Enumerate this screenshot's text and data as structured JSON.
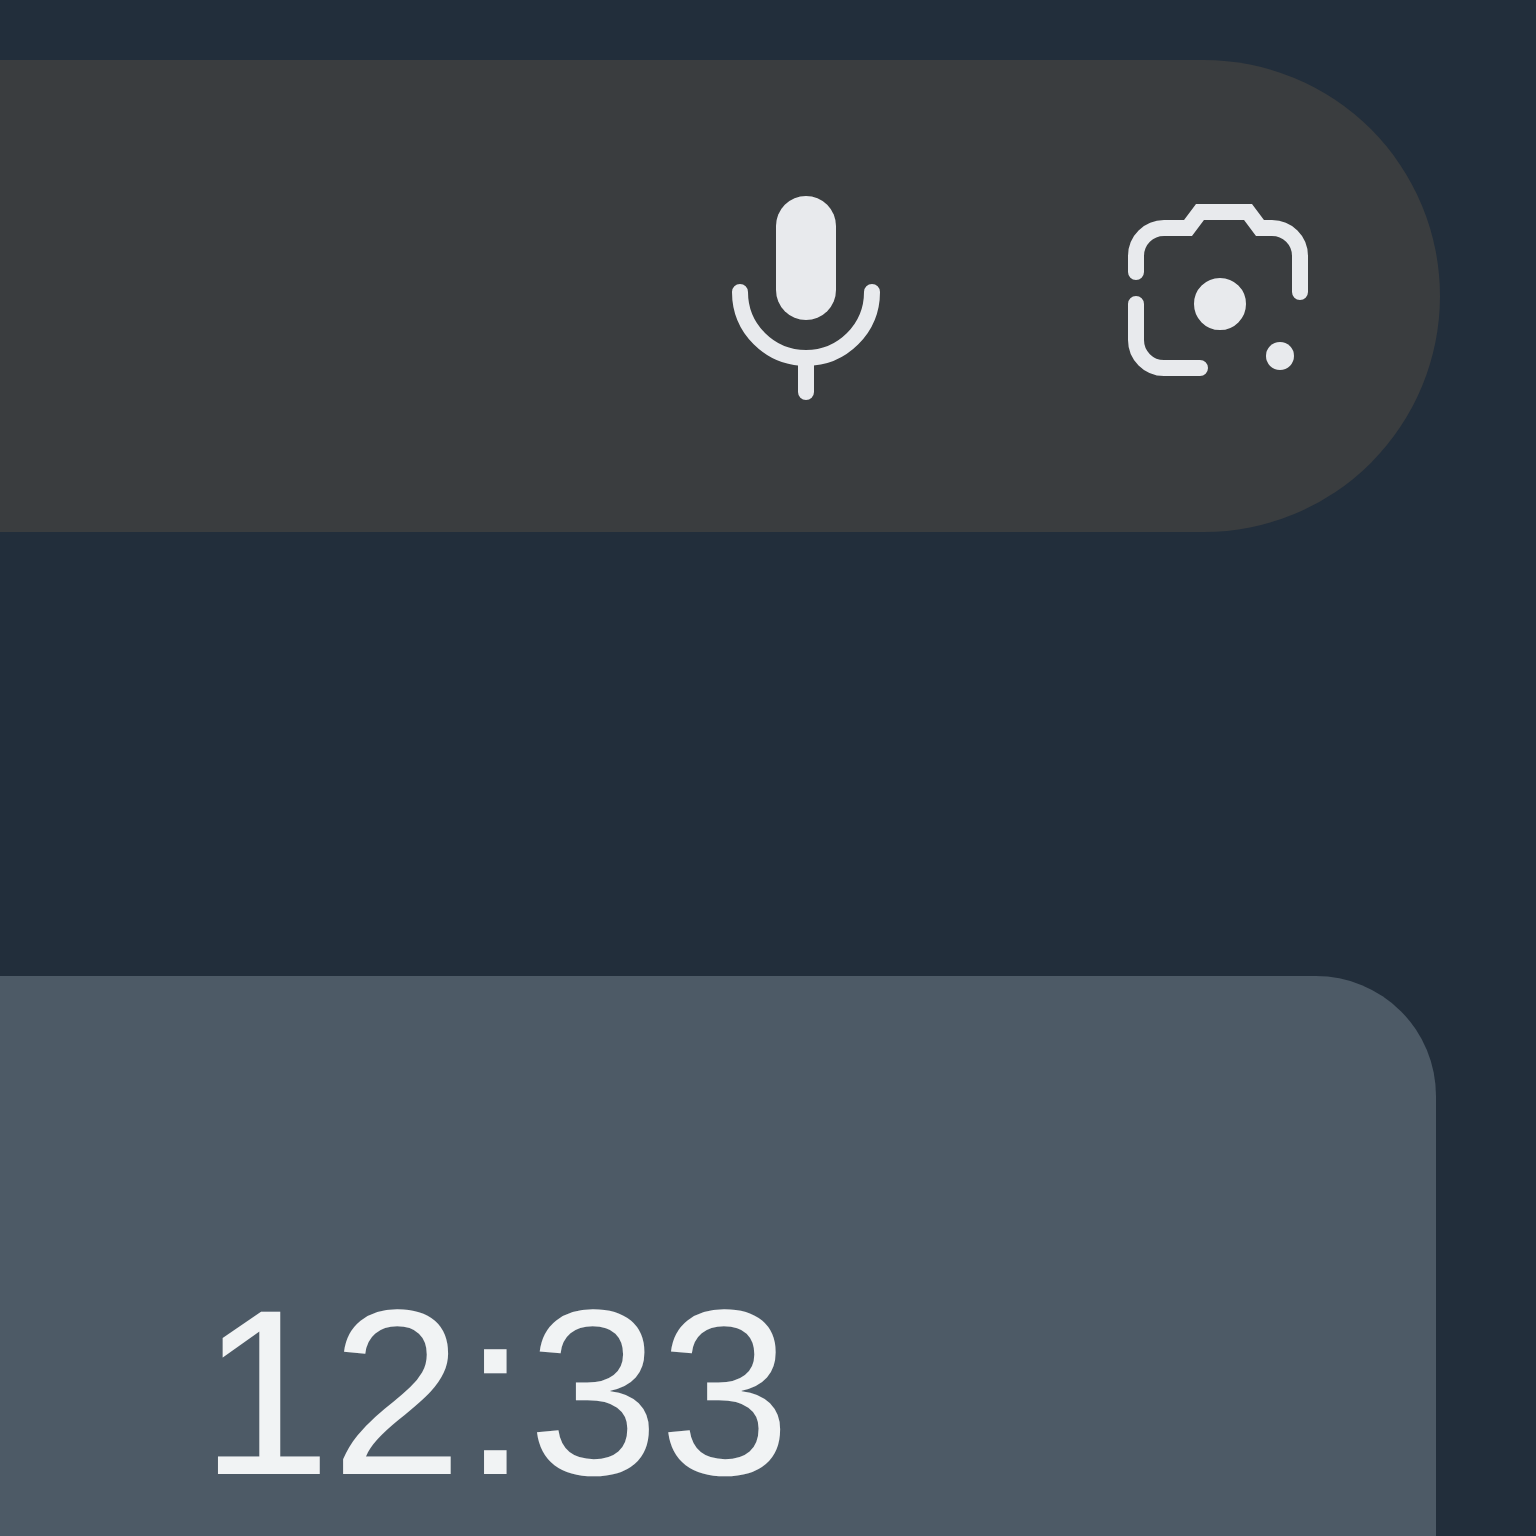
{
  "clock_widget": {
    "time": "12:33"
  }
}
